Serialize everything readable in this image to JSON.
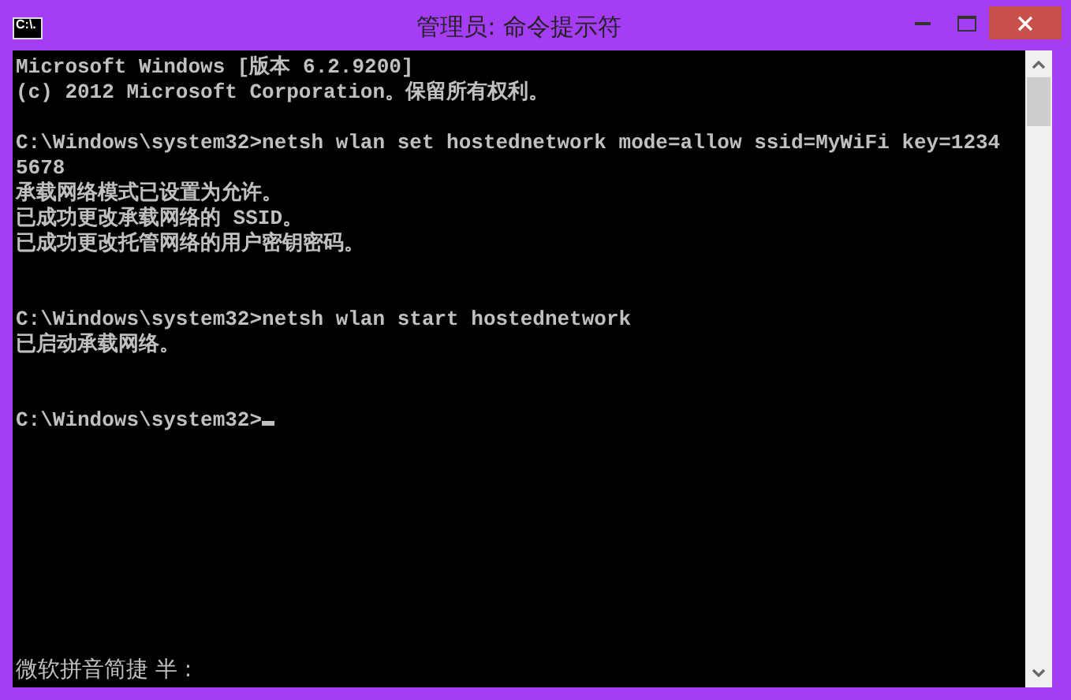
{
  "window": {
    "title": "管理员: 命令提示符",
    "icon_text": "C:\\."
  },
  "console": {
    "lines": [
      {
        "kind": "text",
        "text": "Microsoft Windows [版本 6.2.9200]"
      },
      {
        "kind": "text",
        "text": "(c) 2012 Microsoft Corporation。保留所有权利。"
      },
      {
        "kind": "blank"
      },
      {
        "kind": "text",
        "text": "C:\\Windows\\system32>netsh wlan set hostednetwork mode=allow ssid=MyWiFi key=1234"
      },
      {
        "kind": "text",
        "text": "5678"
      },
      {
        "kind": "text",
        "text": "承载网络模式已设置为允许。"
      },
      {
        "kind": "text",
        "text": "已成功更改承载网络的 SSID。"
      },
      {
        "kind": "text",
        "text": "已成功更改托管网络的用户密钥密码。"
      },
      {
        "kind": "blank"
      },
      {
        "kind": "blank"
      },
      {
        "kind": "text",
        "text": "C:\\Windows\\system32>netsh wlan start hostednetwork"
      },
      {
        "kind": "text",
        "text": "已启动承载网络。"
      },
      {
        "kind": "blank"
      },
      {
        "kind": "blank"
      },
      {
        "kind": "text",
        "text": "C:\\Windows\\system32>"
      }
    ],
    "cursor_visible": true,
    "ime_status": "微软拼音简捷 半 :"
  }
}
